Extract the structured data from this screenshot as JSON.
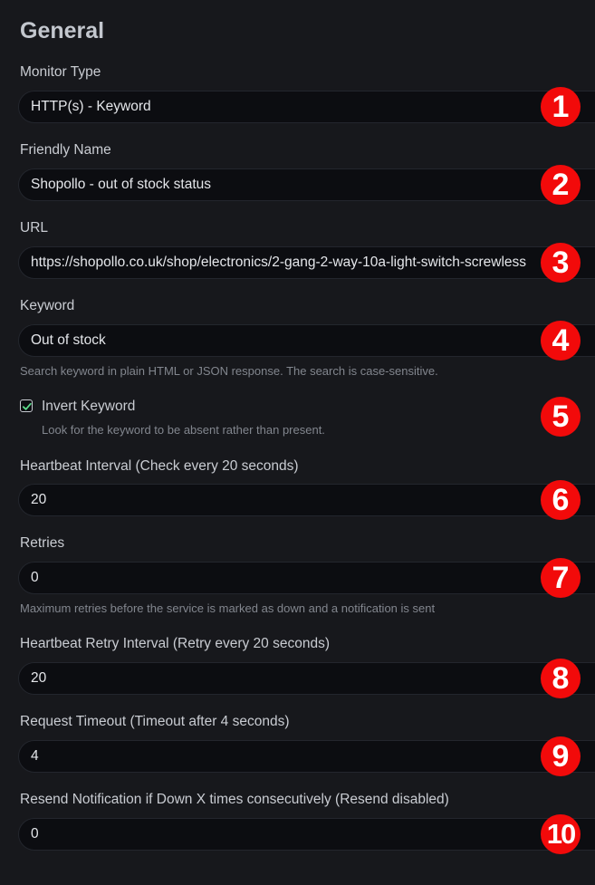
{
  "section": {
    "title": "General"
  },
  "fields": {
    "monitor_type": {
      "label": "Monitor Type",
      "value": "HTTP(s) - Keyword"
    },
    "friendly_name": {
      "label": "Friendly Name",
      "value": "Shopollo - out of stock status"
    },
    "url": {
      "label": "URL",
      "value": "https://shopollo.co.uk/shop/electronics/2-gang-2-way-10a-light-switch-screwless"
    },
    "keyword": {
      "label": "Keyword",
      "value": "Out of stock",
      "help": "Search keyword in plain HTML or JSON response. The search is case-sensitive."
    },
    "invert_keyword": {
      "label": "Invert Keyword",
      "checked": true,
      "help": "Look for the keyword to be absent rather than present."
    },
    "heartbeat_interval": {
      "label": "Heartbeat Interval (Check every 20 seconds)",
      "value": "20"
    },
    "retries": {
      "label": "Retries",
      "value": "0",
      "help": "Maximum retries before the service is marked as down and a notification is sent"
    },
    "retry_interval": {
      "label": "Heartbeat Retry Interval (Retry every 20 seconds)",
      "value": "20"
    },
    "request_timeout": {
      "label": "Request Timeout (Timeout after 4 seconds)",
      "value": "4"
    },
    "resend_notification": {
      "label": "Resend Notification if Down X times consecutively (Resend disabled)",
      "value": "0"
    }
  },
  "markers": [
    "1",
    "2",
    "3",
    "4",
    "5",
    "6",
    "7",
    "8",
    "9",
    "10"
  ],
  "colors": {
    "background": "#17181c",
    "input_bg": "#0c0d11",
    "marker": "#f20a0a",
    "checkbox_check": "#5cdd8b"
  }
}
